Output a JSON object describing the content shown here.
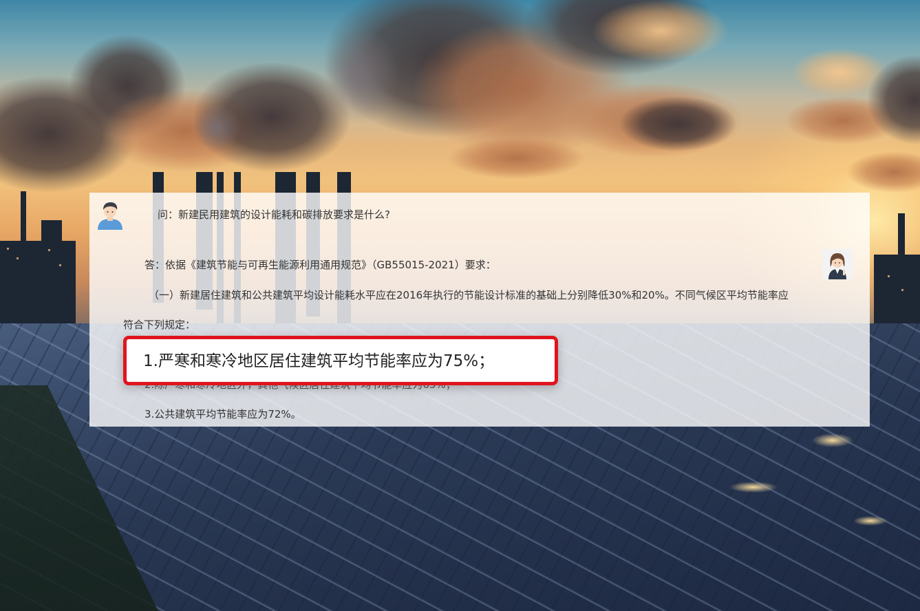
{
  "question": "问：新建民用建筑的设计能耗和碳排放要求是什么?",
  "answer_intro": "答：依据《建筑节能与可再生能源利用通用规范》（GB55015-2021）要求：",
  "paragraph_1": "（一）新建居住建筑和公共建筑平均设计能耗水平应在2016年执行的节能设计标准的基础上分别降低30%和20%。不同气候区平均节能率应",
  "paragraph_2": "符合下列规定：",
  "items": [
    "1.严寒和寒冷地区居住建筑平均节能率应为75%；",
    "2.除严寒和寒冷地区外，其他气候区居住建筑平均节能率应为65%；",
    "3.公共建筑平均节能率应为72%。"
  ],
  "colors": {
    "highlight_border": "#e0141e",
    "card_background": "rgba(255,255,255,0.80)",
    "text": "#333333"
  },
  "icons": {
    "user_avatar": "user-avatar-icon",
    "assistant_avatar": "assistant-avatar-icon"
  }
}
